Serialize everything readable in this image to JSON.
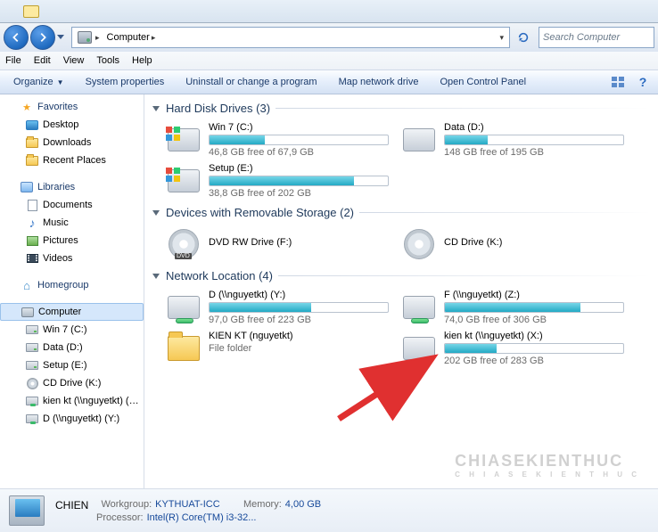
{
  "address": {
    "location": "Computer"
  },
  "search": {
    "placeholder": "Search Computer"
  },
  "menu": {
    "file": "File",
    "edit": "Edit",
    "view": "View",
    "tools": "Tools",
    "help": "Help"
  },
  "toolbar": {
    "organize": "Organize",
    "sysprops": "System properties",
    "uninstall": "Uninstall or change a program",
    "mapdrive": "Map network drive",
    "ctrlpanel": "Open Control Panel"
  },
  "sidebar": {
    "favorites": "Favorites",
    "desktop": "Desktop",
    "downloads": "Downloads",
    "recent": "Recent Places",
    "libraries": "Libraries",
    "documents": "Documents",
    "music": "Music",
    "pictures": "Pictures",
    "videos": "Videos",
    "homegroup": "Homegroup",
    "computer": "Computer",
    "win7": "Win 7 (C:)",
    "data": "Data (D:)",
    "setup": "Setup (E:)",
    "cddrive": "CD Drive (K:)",
    "kienkt": "kien kt (\\\\nguyetkt) (X:)",
    "dnet": "D (\\\\nguyetkt) (Y:)"
  },
  "groups": {
    "hdd": {
      "title": "Hard Disk Drives",
      "count": "(3)"
    },
    "removable": {
      "title": "Devices with Removable Storage",
      "count": "(2)"
    },
    "network": {
      "title": "Network Location",
      "count": "(4)"
    }
  },
  "drives": {
    "c": {
      "name": "Win 7 (C:)",
      "free": "46,8 GB free of 67,9 GB",
      "pct": 31
    },
    "d": {
      "name": "Data (D:)",
      "free": "148 GB free of 195 GB",
      "pct": 24
    },
    "e": {
      "name": "Setup (E:)",
      "free": "38,8 GB free of 202 GB",
      "pct": 81
    },
    "dvd": {
      "name": "DVD RW Drive (F:)"
    },
    "cd": {
      "name": "CD Drive (K:)"
    },
    "y": {
      "name": "D (\\\\nguyetkt) (Y:)",
      "free": "97,0 GB free of 223 GB",
      "pct": 57
    },
    "z": {
      "name": "F (\\\\nguyetkt) (Z:)",
      "free": "74,0 GB free of 306 GB",
      "pct": 76
    },
    "folder": {
      "name": "KIEN KT (nguyetkt)",
      "sub": "File folder"
    },
    "x": {
      "name": "kien kt (\\\\nguyetkt) (X:)",
      "free": "202 GB free of 283 GB",
      "pct": 29
    }
  },
  "details": {
    "name": "CHIEN",
    "wg_k": "Workgroup:",
    "wg_v": "KYTHUAT-ICC",
    "mem_k": "Memory:",
    "mem_v": "4,00 GB",
    "cpu_k": "Processor:",
    "cpu_v": "Intel(R) Core(TM) i3-32..."
  },
  "watermark": {
    "big": "CHIASEKIENTHUC",
    "small": "C H I A  S E  K I E N  T H U C"
  }
}
